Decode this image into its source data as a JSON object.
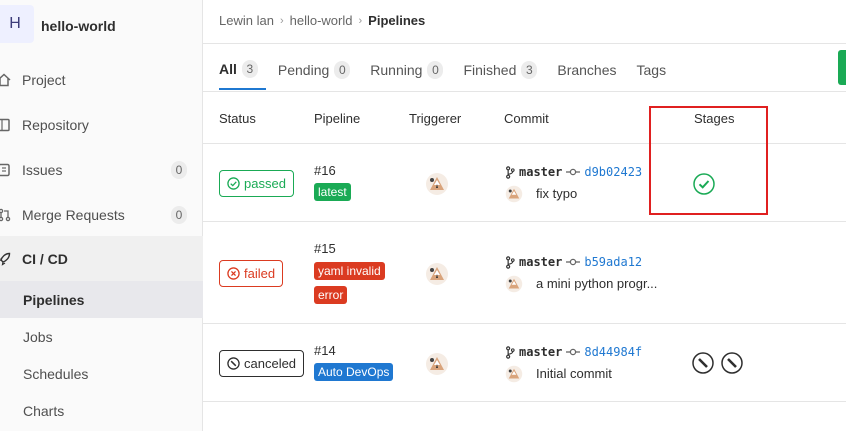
{
  "sidebar": {
    "avatar_letter": "H",
    "project_name": "hello-world",
    "items": [
      {
        "label": "Project",
        "icon": "home-icon"
      },
      {
        "label": "Repository",
        "icon": "book-icon"
      },
      {
        "label": "Issues",
        "icon": "issues-icon",
        "count": "0"
      },
      {
        "label": "Merge Requests",
        "icon": "merge-request-icon",
        "count": "0"
      },
      {
        "label": "CI / CD",
        "icon": "rocket-icon"
      }
    ],
    "sub_items": [
      {
        "label": "Pipelines"
      },
      {
        "label": "Jobs"
      },
      {
        "label": "Schedules"
      },
      {
        "label": "Charts"
      }
    ]
  },
  "breadcrumb": {
    "items": [
      "Lewin lan",
      "hello-world",
      "Pipelines"
    ]
  },
  "tabs": [
    {
      "label": "All",
      "count": "3"
    },
    {
      "label": "Pending",
      "count": "0"
    },
    {
      "label": "Running",
      "count": "0"
    },
    {
      "label": "Finished",
      "count": "3"
    },
    {
      "label": "Branches"
    },
    {
      "label": "Tags"
    }
  ],
  "table": {
    "headers": [
      "Status",
      "Pipeline",
      "Triggerer",
      "Commit",
      "Stages"
    ],
    "rows": [
      {
        "status": "passed",
        "id": "#16",
        "labels": [
          "latest"
        ],
        "branch": "master",
        "sha": "d9b02423",
        "message": "fix typo"
      },
      {
        "status": "failed",
        "id": "#15",
        "labels": [
          "yaml invalid",
          "error"
        ],
        "branch": "master",
        "sha": "b59ada12",
        "message": "a mini python progr..."
      },
      {
        "status": "canceled",
        "id": "#14",
        "labels": [
          "Auto DevOps"
        ],
        "branch": "master",
        "sha": "8d44984f",
        "message": "Initial commit"
      }
    ]
  },
  "colors": {
    "passed": "#1aaa55",
    "failed": "#db3b21",
    "link": "#1f78d1",
    "highlight": "#e02020"
  }
}
